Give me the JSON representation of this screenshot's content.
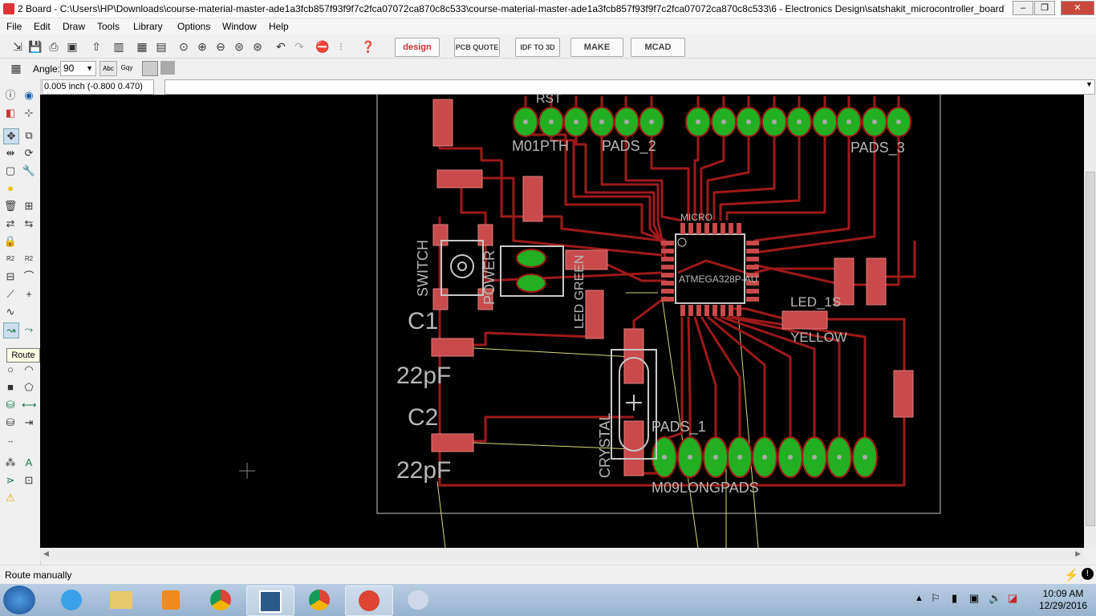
{
  "window": {
    "title": "2 Board - C:\\Users\\HP\\Downloads\\course-material-master-ade1a3fcb857f93f9f7c2fca07072ca870c8c533\\course-material-master-ade1a3fcb857f93f9f7c2fca07072ca870c8c533\\6 - Electronics Design\\satshakit_microcontroller_board\\..."
  },
  "menu": [
    "File",
    "Edit",
    "Draw",
    "Tools",
    "Library",
    "Options",
    "Window",
    "Help"
  ],
  "toolbar": {
    "design_link": "design link",
    "pcb_quote": "PCB QUOTE",
    "idf_to_3d": "IDF TO 3D",
    "make": "MAKE",
    "mcad": "MCAD"
  },
  "params": {
    "angle_label": "Angle:",
    "angle_value": "90",
    "abc_label": "Abc",
    "gqy_label": "Gqy"
  },
  "command": {
    "coordinates": "0.005 inch (-0.800 0.470)"
  },
  "tooltip": "Route",
  "board": {
    "labels": {
      "rst": "RST",
      "m01pth": "M01PTH",
      "pads_2": "PADS_2",
      "pads_3": "PADS_3",
      "micro": "MICRO",
      "atmega": "ATMEGA328P-AU",
      "switch": "SWITCH",
      "power": "POWER",
      "led_green": "LED GREEN",
      "led_yellow_name": "LED_1S",
      "yellow": "YELLOW",
      "c1": "C1",
      "c1_val": "22pF",
      "c2": "C2",
      "c2_val": "22pF",
      "crystal": "CRYSTAL",
      "pads_1": "PADS_1",
      "m09longpads": "M09LONGPADS"
    },
    "colors": {
      "trace": "#9e1a1a",
      "pad": "#22b022",
      "smd": "#c84a4a",
      "outline": "#c8c8c8",
      "airwire": "#d8d878"
    }
  },
  "status": "Route manually",
  "clock": {
    "time": "10:09 AM",
    "date": "12/29/2016"
  }
}
